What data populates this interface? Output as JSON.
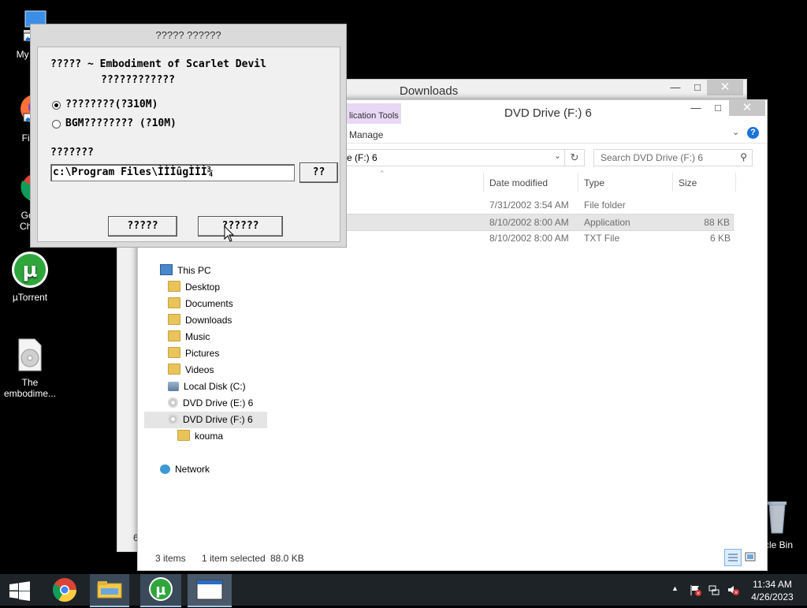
{
  "desktop": {
    "icons": [
      {
        "label": "My Co"
      },
      {
        "label": "Fire"
      },
      {
        "label1": "Goo",
        "label2": "Chro"
      },
      {
        "label": "µTorrent"
      },
      {
        "label1": "The",
        "label2": "embodime..."
      },
      {
        "label": "cle Bin"
      }
    ]
  },
  "downloads_window": {
    "title": "Downloads",
    "min": "—",
    "max": "□",
    "close": "✕",
    "footer_char": "6"
  },
  "dvd_window": {
    "title": "DVD Drive (F:) 6",
    "min": "—",
    "max": "□",
    "close": "✕",
    "ribbon_context_tab": "lication Tools",
    "ribbon_manage_tab": "Manage",
    "address": "e (F:) 6",
    "search_placeholder": "Search DVD Drive (F:) 6",
    "columns": {
      "date": "Date modified",
      "type": "Type",
      "size": "Size"
    },
    "rows": [
      {
        "date": "7/31/2002 3:54 AM",
        "type": "File folder",
        "size": ""
      },
      {
        "date": "8/10/2002 8:00 AM",
        "type": "Application",
        "size": "88 KB"
      },
      {
        "date": "8/10/2002 8:00 AM",
        "type": "TXT File",
        "size": "6 KB"
      }
    ],
    "tree": {
      "this_pc": "This PC",
      "desktop": "Desktop",
      "documents": "Documents",
      "downloads": "Downloads",
      "music": "Music",
      "pictures": "Pictures",
      "videos": "Videos",
      "local_disk": "Local Disk (C:)",
      "dvd_e": "DVD Drive (E:) 6",
      "dvd_f": "DVD Drive (F:) 6",
      "kouma": "kouma",
      "network": "Network"
    },
    "status": {
      "items": "3 items",
      "selected": "1 item selected",
      "size": "88.0 KB"
    }
  },
  "installer": {
    "title": "????? ??????",
    "heading1": "????? ~ Embodiment of Scarlet Devil",
    "heading2": "????????????",
    "option1": "????????(?310M)",
    "option2": "BGM???????? (?10M)",
    "path_label": "???????",
    "path_value": "c:\\Program Files\\ÌÌÌûgÌÌÌ¾",
    "browse_button": "??",
    "button_left": "?????",
    "button_right": "??????",
    "option1_selected": true
  },
  "taskbar": {
    "time": "11:34 AM",
    "date": "4/26/2023",
    "tray_chevron": "▲"
  },
  "colors": {
    "desktop_bg": "#000000",
    "taskbar_bg": "#1e2328",
    "ribbon_context_bg": "#e8d7f5",
    "selection_bg": "#e5e5e5"
  }
}
